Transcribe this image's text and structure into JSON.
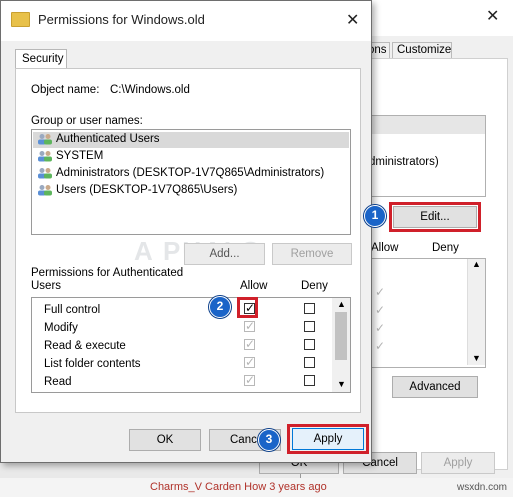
{
  "bg_dialog": {
    "tabs": [
      "ons",
      "Customize"
    ],
    "text_administrators": "dministrators)",
    "edit_label": "Edit...",
    "col_allow": "Allow",
    "col_deny": "Deny",
    "advanced_label": "Advanced",
    "ok_label": "OK",
    "cancel_label": "Cancel",
    "apply_label": "Apply"
  },
  "dialog": {
    "title": "Permissions for Windows.old",
    "tab_security": "Security",
    "object_name_label": "Object name:",
    "object_name_value": "C:\\Windows.old",
    "group_label": "Group or user names:",
    "users": [
      "Authenticated Users",
      "SYSTEM",
      "Administrators (DESKTOP-1V7Q865\\Administrators)",
      "Users (DESKTOP-1V7Q865\\Users)"
    ],
    "add_label": "Add...",
    "remove_label": "Remove",
    "perm_label_line1": "Permissions for Authenticated",
    "perm_label_line2": "Users",
    "allow_header": "Allow",
    "deny_header": "Deny",
    "permissions": [
      "Full control",
      "Modify",
      "Read & execute",
      "List folder contents",
      "Read"
    ],
    "ok_label": "OK",
    "cancel_label": "Cance",
    "apply_label": "Apply"
  },
  "badges": [
    "1",
    "2",
    "3"
  ],
  "watermark": "A  PUALS",
  "footer_source": "wsxdn.com",
  "bottom_text": "Charms_V  Carden  How  3 years ago"
}
